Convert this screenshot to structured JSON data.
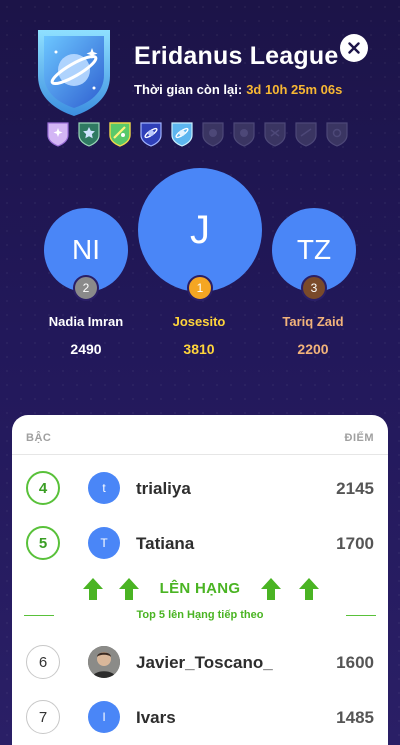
{
  "header": {
    "league_name": "Eridanus League",
    "time_label": "Thời gian còn lại:",
    "time_value": "3d 10h 25m 06s"
  },
  "league_badges": [
    {
      "icon": "purple-star-badge-icon",
      "color": "#c79bf2",
      "active": true
    },
    {
      "icon": "green-star-badge-icon",
      "color": "#3d8c6a",
      "active": true
    },
    {
      "icon": "yellow-badge-icon",
      "color": "#e4c84a",
      "active": true
    },
    {
      "icon": "blue-planet-badge-icon",
      "color": "#4a5ad6",
      "active": true
    },
    {
      "icon": "eridanus-badge-icon",
      "color": "#8fd1f2",
      "active": true
    },
    {
      "icon": "locked-badge-icon",
      "color": "#3f3a66",
      "active": false
    },
    {
      "icon": "locked-badge-icon",
      "color": "#3f3a66",
      "active": false
    },
    {
      "icon": "locked-badge-icon",
      "color": "#3f3a66",
      "active": false
    },
    {
      "icon": "locked-badge-icon",
      "color": "#3f3a66",
      "active": false
    },
    {
      "icon": "locked-badge-icon",
      "color": "#3f3a66",
      "active": false
    }
  ],
  "podium": {
    "second": {
      "initials": "NI",
      "rank": "2",
      "name": "Nadia Imran",
      "score": "2490",
      "color": "#ffffff"
    },
    "first": {
      "initials": "J",
      "rank": "1",
      "name": "Josesito",
      "score": "3810",
      "color": "#ffd43b"
    },
    "third": {
      "initials": "TZ",
      "rank": "3",
      "name": "Tariq Zaid",
      "score": "2200",
      "color": "#f2b37a"
    }
  },
  "leaderboard": {
    "col_rank": "BẬC",
    "col_points": "ĐIỂM",
    "rows": [
      {
        "rank": "4",
        "avatar": "t",
        "name": "trialiya",
        "points": "2145"
      },
      {
        "rank": "5",
        "avatar": "T",
        "name": "Tatiana",
        "points": "1700"
      },
      {
        "rank": "6",
        "avatar": "",
        "name": "Javier_Toscano_",
        "points": "1600"
      },
      {
        "rank": "7",
        "avatar": "I",
        "name": "Ivars",
        "points": "1485"
      }
    ],
    "promotion": {
      "title": "LÊN HẠNG",
      "subtitle": "Top 5 lên Hạng tiếp theo"
    }
  },
  "colors": {
    "accent_green": "#4ab423",
    "avatar_blue": "#4a86f7",
    "gold": "#f7b733"
  }
}
